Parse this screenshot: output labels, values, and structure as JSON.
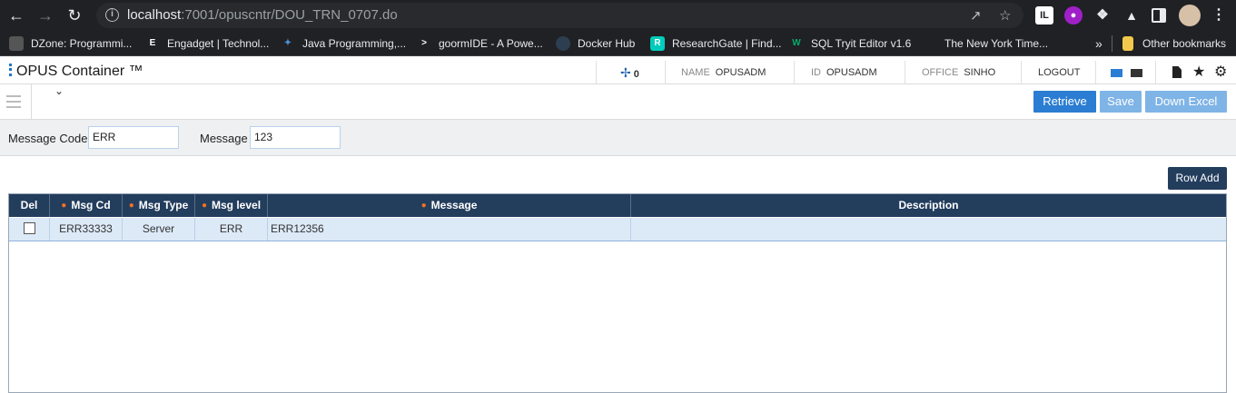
{
  "browser": {
    "url_host": "localhost",
    "url_rest": ":7001/opuscntr/DOU_TRN_0707.do",
    "bookmarks": [
      "DZone: Programmi...",
      "Engadget | Technol...",
      "Java Programming,...",
      "goormIDE - A Powe...",
      "Docker Hub",
      "ResearchGate | Find...",
      "SQL Tryit Editor v1.6",
      "The New York Time..."
    ],
    "other_bookmarks": "Other bookmarks",
    "more": "»"
  },
  "header": {
    "logo": "OPUS Container ™",
    "count": "0",
    "name_label": "NAME",
    "name_value": "OPUSADM",
    "id_label": "ID",
    "id_value": "OPUSADM",
    "office_label": "OFFICE",
    "office_value": "SINHO",
    "logout": "LOGOUT"
  },
  "toolbar": {
    "retrieve": "Retrieve",
    "save": "Save",
    "down_excel": "Down Excel"
  },
  "search": {
    "code_label": "Message Code",
    "code_value": "ERR",
    "message_label": "Message",
    "message_value": "123"
  },
  "row_add": "Row Add",
  "grid": {
    "columns": [
      "Del",
      "Msg Cd",
      "Msg Type",
      "Msg level",
      "Message",
      "Description"
    ],
    "rows": [
      {
        "msg_cd": "ERR33333",
        "msg_type": "Server",
        "msg_level": "ERR",
        "message": "ERR12356",
        "description": ""
      }
    ]
  },
  "colors": {
    "grid_header": "#233d5d",
    "primary_button": "#2a7dd2",
    "disabled_button": "#7fb4e6",
    "required_dot": "#f37021",
    "selected_row": "#dce9f7"
  }
}
